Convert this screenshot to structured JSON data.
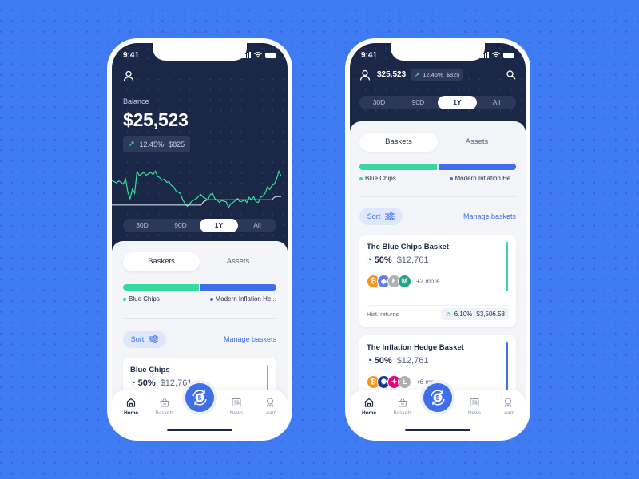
{
  "status_bar": {
    "time": "9:41"
  },
  "phone1": {
    "balance_label": "Balance",
    "balance": "$25,523",
    "change_pct": "12.45%",
    "change_amt": "$825",
    "chart_data": {
      "type": "line",
      "series": [
        {
          "name": "portfolio",
          "values": [
            48,
            46,
            44,
            47,
            45,
            42,
            50,
            30,
            20,
            35,
            28,
            62,
            55,
            58,
            60,
            56,
            58,
            60,
            57,
            62,
            54,
            52,
            48,
            50,
            45,
            46,
            40,
            38,
            32,
            30,
            28,
            18,
            12,
            8,
            12,
            16,
            18,
            20,
            24,
            26,
            22,
            20,
            18,
            26,
            28,
            20,
            18,
            14,
            17,
            16,
            15,
            6,
            12,
            14,
            17,
            20,
            15,
            16,
            18,
            14,
            22,
            18,
            23,
            15,
            14,
            22,
            24,
            28,
            38,
            34,
            40,
            42,
            50,
            62,
            54
          ]
        },
        {
          "name": "benchmark",
          "values": [
            10,
            10,
            10,
            10,
            10,
            10,
            10,
            10,
            10,
            10,
            10,
            10,
            10,
            10,
            10,
            10,
            10,
            10,
            10,
            10,
            10,
            10,
            10,
            10,
            10,
            10,
            10,
            10,
            10,
            10,
            10,
            10,
            10,
            10,
            10,
            10,
            10,
            10,
            10,
            10,
            15,
            17,
            18,
            18,
            18,
            18,
            18,
            18,
            18,
            18,
            18,
            18,
            18,
            18,
            18,
            18,
            18,
            18,
            18,
            18,
            18,
            18,
            18,
            18,
            18,
            18,
            18,
            18,
            18,
            18,
            18,
            22,
            23,
            23,
            23
          ]
        }
      ],
      "ylim": [
        0,
        70
      ]
    },
    "ranges": [
      "30D",
      "90D",
      "1Y",
      "All"
    ],
    "active_range": "1Y",
    "tabs": [
      "Baskets",
      "Assets"
    ],
    "allocation": [
      {
        "name": "Blue Chips",
        "share": 0.5,
        "color": "#38d9a0"
      },
      {
        "name": "Modern Inflation He...",
        "share": 0.5,
        "color": "#3f6fe8"
      }
    ],
    "sort_label": "Sort",
    "manage_label": "Manage baskets",
    "card": {
      "title": "Blue Chips",
      "pct": "50%",
      "amount": "$12,761",
      "color": "#38d9a0"
    }
  },
  "phone2": {
    "balance": "$25,523",
    "change_pct": "12.45%",
    "change_amt": "$825",
    "ranges": [
      "30D",
      "90D",
      "1Y",
      "All"
    ],
    "active_range": "1Y",
    "tabs": [
      "Baskets",
      "Assets"
    ],
    "allocation": [
      {
        "name": "Blue Chips",
        "share": 0.5,
        "color": "#38d9a0"
      },
      {
        "name": "Modern Inflation He...",
        "share": 0.5,
        "color": "#3f6fe8"
      }
    ],
    "sort_label": "Sort",
    "manage_label": "Manage baskets",
    "cards": [
      {
        "title": "The Blue Chips Basket",
        "pct": "50%",
        "amount": "$12,761",
        "color": "#38d9a0",
        "coins": [
          {
            "sym": "₿",
            "color": "#f7931a"
          },
          {
            "sym": "◆",
            "color": "#627eea"
          },
          {
            "sym": "Ł",
            "color": "#b0b0b0"
          },
          {
            "sym": "M",
            "color": "#1fa88a"
          }
        ],
        "more": "+2 more",
        "hist_label": "Hist. returns",
        "hist_pct": "6.10%",
        "hist_amt": "$3,506.58"
      },
      {
        "title": "The Inflation Hedge Basket",
        "pct": "50%",
        "amount": "$12,761",
        "color": "#3f6fe8",
        "coins": [
          {
            "sym": "₿",
            "color": "#f7931a"
          },
          {
            "sym": "✺",
            "color": "#1a3a8f"
          },
          {
            "sym": "✦",
            "color": "#e6007a"
          },
          {
            "sym": "Ł",
            "color": "#b0b0b0"
          }
        ],
        "more": "+6 more"
      }
    ]
  },
  "nav": {
    "items": [
      "Home",
      "Baskets",
      "News",
      "Learn"
    ],
    "active": "Home"
  }
}
